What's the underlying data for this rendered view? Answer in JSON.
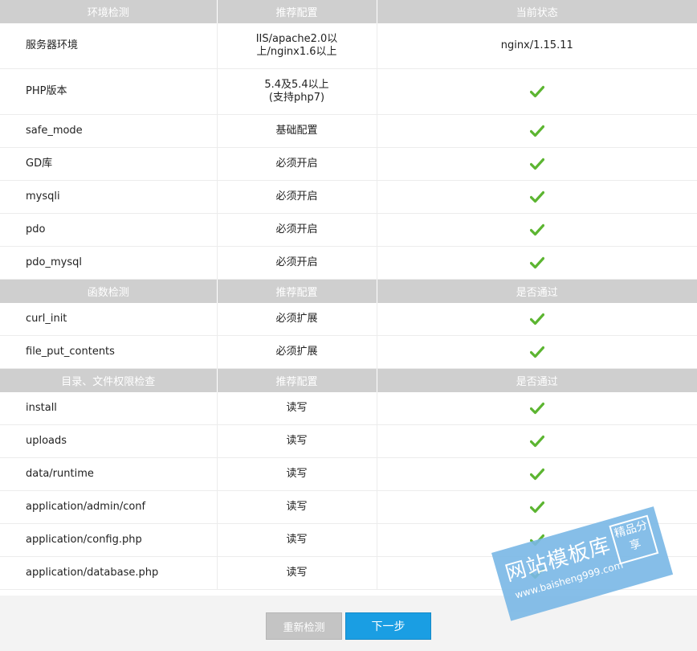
{
  "sections": [
    {
      "header": [
        "环境检测",
        "推荐配置",
        "当前状态"
      ],
      "rows": [
        {
          "name": "服务器环境",
          "recommend": "IIS/apache2.0以\n上/nginx1.6以上",
          "status": "nginx/1.15.11",
          "tall": true
        },
        {
          "name": "PHP版本",
          "recommend": "5.4及5.4以上\n(支持php7)",
          "status": "check",
          "tall": true
        },
        {
          "name": "safe_mode",
          "recommend": "基础配置",
          "status": "check"
        },
        {
          "name": "GD库",
          "recommend": "必须开启",
          "status": "check"
        },
        {
          "name": "mysqli",
          "recommend": "必须开启",
          "status": "check"
        },
        {
          "name": "pdo",
          "recommend": "必须开启",
          "status": "check"
        },
        {
          "name": "pdo_mysql",
          "recommend": "必须开启",
          "status": "check"
        }
      ]
    },
    {
      "header": [
        "函数检测",
        "推荐配置",
        "是否通过"
      ],
      "rows": [
        {
          "name": "curl_init",
          "recommend": "必须扩展",
          "status": "check"
        },
        {
          "name": "file_put_contents",
          "recommend": "必须扩展",
          "status": "check"
        }
      ]
    },
    {
      "header": [
        "目录、文件权限检查",
        "推荐配置",
        "是否通过"
      ],
      "rows": [
        {
          "name": "install",
          "recommend": "读写",
          "status": "check"
        },
        {
          "name": "uploads",
          "recommend": "读写",
          "status": "check"
        },
        {
          "name": "data/runtime",
          "recommend": "读写",
          "status": "check"
        },
        {
          "name": "application/admin/conf",
          "recommend": "读写",
          "status": "check"
        },
        {
          "name": "application/config.php",
          "recommend": "读写",
          "status": "check"
        },
        {
          "name": "application/database.php",
          "recommend": "读写",
          "status": "check"
        }
      ]
    }
  ],
  "buttons": {
    "recheck": "重新检测",
    "next": "下一步"
  },
  "watermark": {
    "title": "网站模板库",
    "url": "www.baisheng999.com",
    "badge": "精品分享"
  },
  "colors": {
    "header_bg": "#cfcfcf",
    "check_green": "#5cb531",
    "next_button": "#1a9ee3",
    "recheck_button": "#c4c4c4"
  },
  "icons": {
    "status_ok": "green-check-icon"
  }
}
